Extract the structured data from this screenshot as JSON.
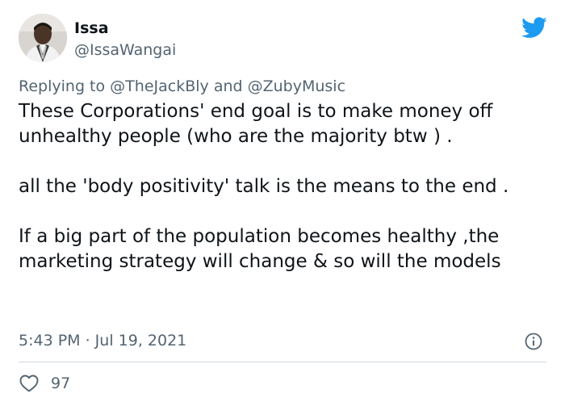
{
  "author": {
    "display_name": "Issa",
    "handle": "@IssaWangai"
  },
  "reply": {
    "prefix": "Replying to",
    "mention_1": "@TheJackBly",
    "joiner": "and",
    "mention_2": "@ZubyMusic"
  },
  "tweet": {
    "paragraphs": [
      "These Corporations' end goal is to make money off unhealthy people (who are the majority btw ) .",
      "all the 'body positivity' talk is the means to the end .",
      "If a big part of the population becomes healthy ,the marketing strategy will change & so will the models"
    ],
    "timestamp": "5:43 PM · Jul 19, 2021"
  },
  "engagement": {
    "likes": "97"
  },
  "icons": {
    "brand": "twitter-bird-icon",
    "info": "info-icon",
    "like": "heart-icon"
  },
  "colors": {
    "brand": "#1d9bf0",
    "text": "#0f1419",
    "secondary": "#536471",
    "divider": "#cfd9de"
  }
}
